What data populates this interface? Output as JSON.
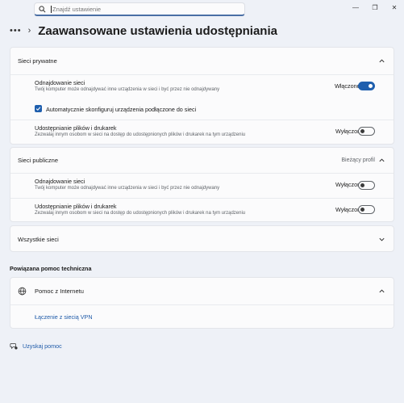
{
  "search": {
    "placeholder": "Znajdź ustawienie"
  },
  "window": {
    "minimize": "—",
    "maximize": "❐",
    "close": "✕"
  },
  "header": {
    "more": "•••",
    "title": "Zaawansowane ustawienia udostępniania"
  },
  "private": {
    "title": "Sieci prywatne",
    "discovery": {
      "title": "Odnajdowanie sieci",
      "desc": "Twój komputer może odnajdywać inne urządzenia w sieci i być przez nie odnajdywany",
      "state": "Włączone",
      "on": true
    },
    "autoconfig": {
      "label": "Automatycznie skonfiguruj urządzenia podłączone do sieci",
      "checked": true
    },
    "sharing": {
      "title": "Udostępnianie plików i drukarek",
      "desc": "Zezwalaj innym osobom w sieci na dostęp do udostępnionych plików i drukarek na tym urządzeniu",
      "state": "Wyłączone",
      "on": false
    }
  },
  "public": {
    "title": "Sieci publiczne",
    "profile": "Bieżący profil",
    "discovery": {
      "title": "Odnajdowanie sieci",
      "desc": "Twój komputer może odnajdywać inne urządzenia w sieci i być przez nie odnajdywany",
      "state": "Wyłączone",
      "on": false
    },
    "sharing": {
      "title": "Udostępnianie plików i drukarek",
      "desc": "Zezwalaj innym osobom w sieci na dostęp do udostępnionych plików i drukarek na tym urządzeniu",
      "state": "Wyłączone",
      "on": false
    }
  },
  "all": {
    "title": "Wszystkie sieci"
  },
  "related": {
    "heading": "Powiązana pomoc techniczna",
    "internet_help": "Pomoc z Internetu",
    "vpn_link": "Łączenie z siecią VPN"
  },
  "get_help": "Uzyskaj pomoc",
  "colors": {
    "accent": "#1f5fae",
    "link": "#1e5aa8",
    "background": "#eef1f7"
  },
  "icons": [
    "search-icon",
    "chevron-right-icon",
    "chevron-up-icon",
    "chevron-down-icon",
    "globe-icon",
    "help-icon",
    "checkmark-icon"
  ]
}
